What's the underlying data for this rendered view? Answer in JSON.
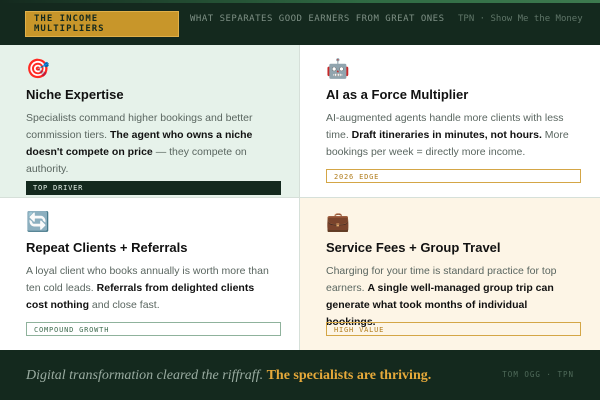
{
  "header": {
    "tag": "THE INCOME MULTIPLIERS",
    "headline": "WHAT SEPARATES GOOD EARNERS FROM GREAT ONES",
    "source": "TPN · Show Me the Money"
  },
  "cards": [
    {
      "icon": "🎯",
      "icon_name": "target-icon",
      "title": "Niche Expertise",
      "body_pre": "Specialists command higher bookings and better commission tiers. ",
      "body_bold": "The agent who owns a niche doesn't compete on price",
      "body_post": " — they compete on authority.",
      "label": "TOP DRIVER"
    },
    {
      "icon": "🤖",
      "icon_name": "robot-icon",
      "title": "AI as a Force Multiplier",
      "body_pre": "AI-augmented agents handle more clients with less time. ",
      "body_bold": "Draft itineraries in minutes, not hours.",
      "body_post": " More bookings per week = directly more income.",
      "label": "2026 EDGE"
    },
    {
      "icon": "🔄",
      "icon_name": "repeat-icon",
      "title": "Repeat Clients + Referrals",
      "body_pre": "A loyal client who books annually is worth more than ten cold leads. ",
      "body_bold": "Referrals from delighted clients cost nothing",
      "body_post": " and close fast.",
      "label": "COMPOUND GROWTH"
    },
    {
      "icon": "💼",
      "icon_name": "briefcase-icon",
      "title": "Service Fees + Group Travel",
      "body_pre": "Charging for your time is standard practice for top earners. ",
      "body_bold": "A single well-managed group trip can generate what took months of individual bookings.",
      "body_post": "",
      "label": "HIGH VALUE"
    }
  ],
  "footer": {
    "quote": "Digital transformation cleared the riffraff.",
    "highlight": "The specialists are thriving.",
    "credit": "TOM OGG · TPN"
  }
}
